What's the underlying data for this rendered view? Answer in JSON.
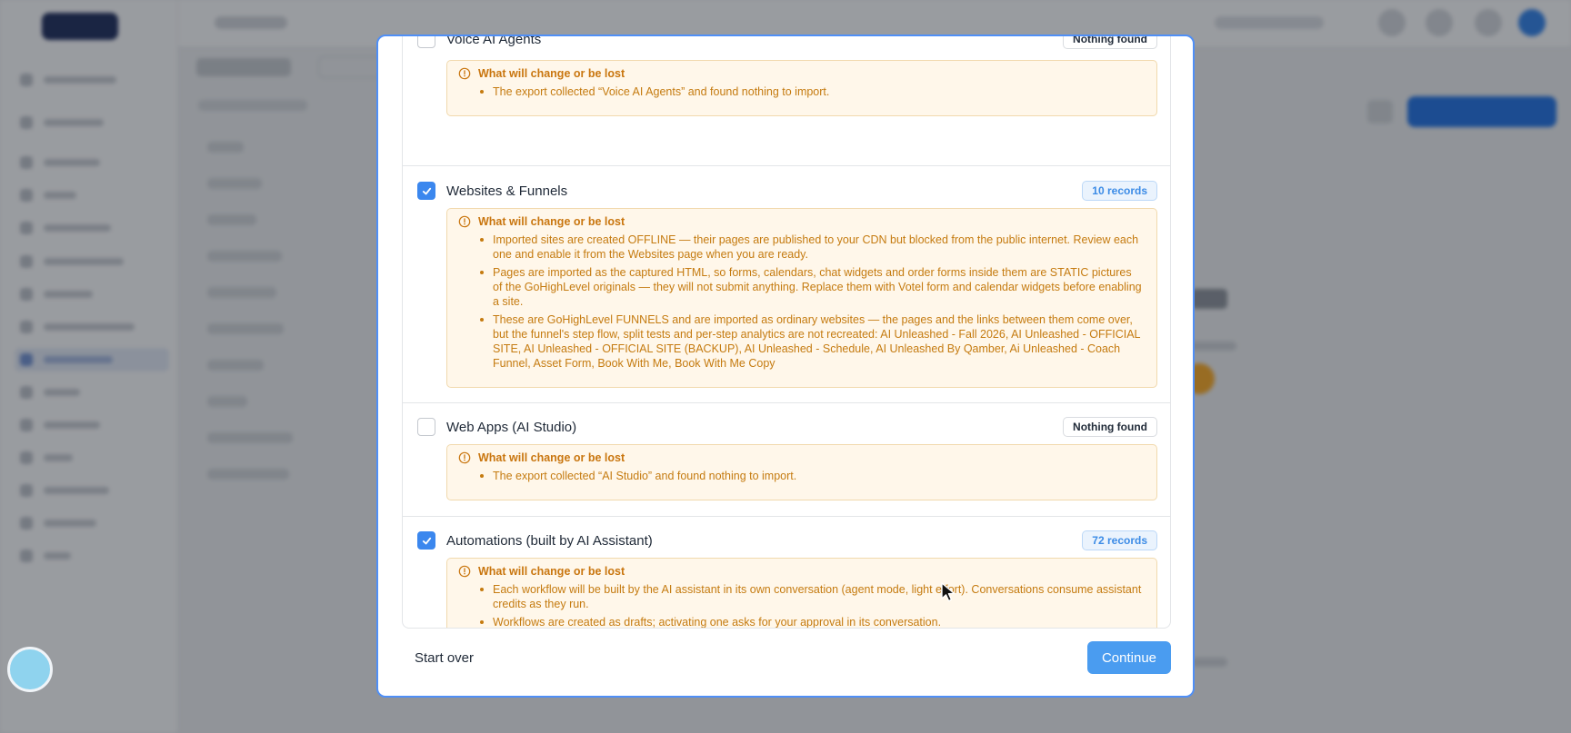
{
  "modal": {
    "sections": [
      {
        "title": "Voice AI Agents",
        "checked": false,
        "badge": "Nothing found",
        "badge_type": "none",
        "warning_title": "What will change or be lost",
        "bullets": [
          "The export collected “Voice AI Agents” and found nothing to import."
        ]
      },
      {
        "title": "Websites & Funnels",
        "checked": true,
        "badge": "10 records",
        "badge_type": "records",
        "warning_title": "What will change or be lost",
        "bullets": [
          "Imported sites are created OFFLINE — their pages are published to your CDN but blocked from the public internet. Review each one and enable it from the Websites page when you are ready.",
          "Pages are imported as the captured HTML, so forms, calendars, chat widgets and order forms inside them are STATIC pictures of the GoHighLevel originals — they will not submit anything. Replace them with Votel form and calendar widgets before enabling a site.",
          "These are GoHighLevel FUNNELS and are imported as ordinary websites — the pages and the links between them come over, but the funnel's step flow, split tests and per-step analytics are not recreated: AI Unleashed - Fall 2026, AI Unleashed - OFFICIAL SITE, AI Unleashed - OFFICIAL SITE (BACKUP), AI Unleashed - Schedule, AI Unleashed By Qamber, Ai Unleashed - Coach Funnel, Asset Form, Book With Me, Book With Me Copy"
        ]
      },
      {
        "title": "Web Apps (AI Studio)",
        "checked": false,
        "badge": "Nothing found",
        "badge_type": "none",
        "warning_title": "What will change or be lost",
        "bullets": [
          "The export collected “AI Studio” and found nothing to import."
        ]
      },
      {
        "title": "Automations (built by AI Assistant)",
        "checked": true,
        "badge": "72 records",
        "badge_type": "records",
        "warning_title": "What will change or be lost",
        "bullets": [
          "Each workflow will be built by the AI assistant in its own conversation (agent mode, light effort). Conversations consume assistant credits as they run.",
          "Workflows are created as drafts; activating one asks for your approval in its conversation."
        ]
      }
    ],
    "start_over_label": "Start over",
    "continue_label": "Continue"
  },
  "colors": {
    "accent": "#3b87ee",
    "warning_bg": "#fff7ea",
    "warning_text": "#c57b10",
    "records_badge": "#3b8be6"
  },
  "icons": [
    "check-icon",
    "warning-circle-icon",
    "cursor-arrow-icon"
  ]
}
